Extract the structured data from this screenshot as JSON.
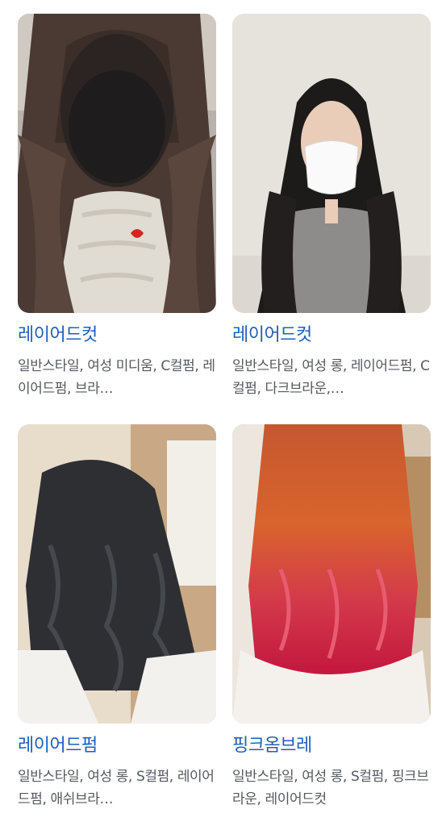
{
  "results": [
    {
      "title": "레이어드컷",
      "desc": "일반스타일, 여성 미디움, C컬펌, 레이어드펌, 브라…",
      "image": "woman-blurred-face-layered-brown-hair"
    },
    {
      "title": "레이어드컷",
      "desc": "일반스타일, 여성 롱, 레이어드펌, C컬펌, 다크브라운,…",
      "image": "woman-white-mask-long-black-layered-hair"
    },
    {
      "title": "레이어드펌",
      "desc": "일반스타일, 여성 롱, S컬펌, 레이어드펌, 애쉬브라…",
      "image": "back-view-black-wavy-hair"
    },
    {
      "title": "핑크옴브레",
      "desc": "일반스타일, 여성 롱, S컬펌, 핑크브라운, 레이어드컷",
      "image": "back-view-orange-pink-ombre-hair"
    }
  ]
}
